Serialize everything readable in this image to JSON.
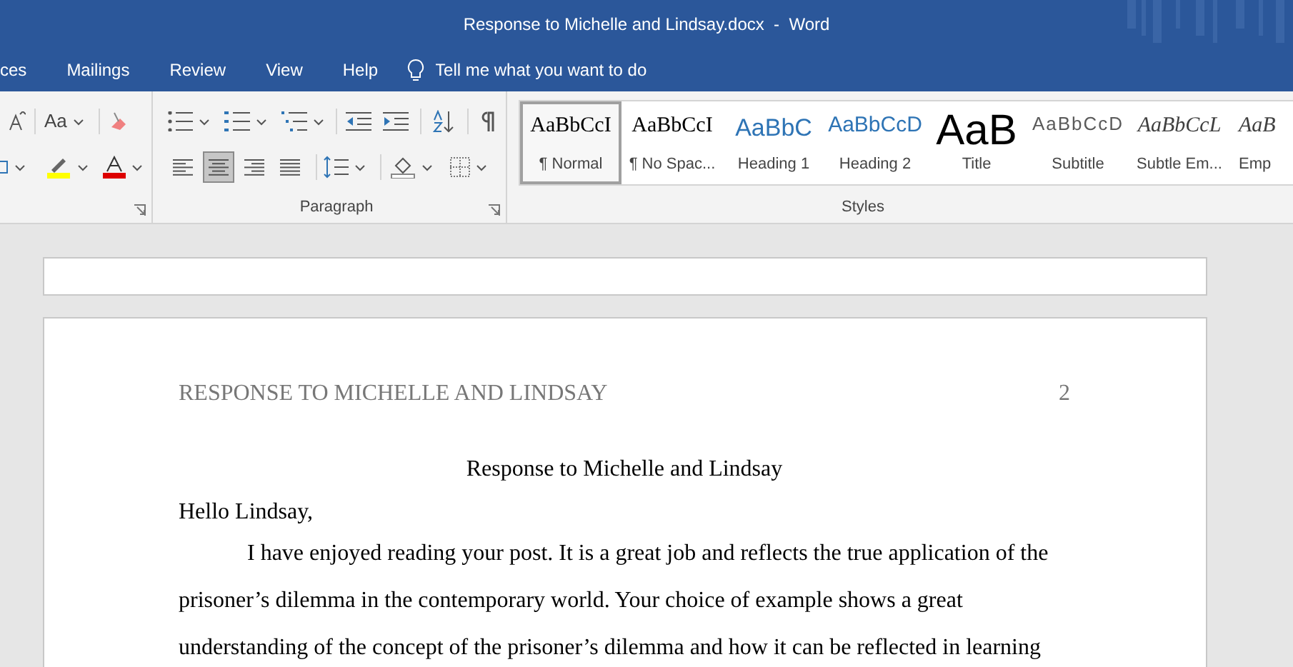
{
  "window": {
    "title": "Response to Michelle and Lindsay.docx  -  Word"
  },
  "tabs": [
    {
      "label": "ces",
      "selected": false
    },
    {
      "label": "Mailings",
      "selected": false
    },
    {
      "label": "Review",
      "selected": false
    },
    {
      "label": "View",
      "selected": false
    },
    {
      "label": "Help",
      "selected": false
    }
  ],
  "tell_me": {
    "placeholder": "Tell me what you want to do"
  },
  "font_group": {
    "change_case": "Aa"
  },
  "paragraph_group": {
    "label": "Paragraph",
    "alignment": [
      {
        "kind": "left",
        "selected": false
      },
      {
        "kind": "center",
        "selected": true
      },
      {
        "kind": "right",
        "selected": false
      },
      {
        "kind": "justify",
        "selected": false
      }
    ]
  },
  "styles_group": {
    "label": "Styles",
    "styles": [
      {
        "kind": "serif",
        "preview": "AaBbCcI",
        "label": "¶ Normal",
        "selected": true
      },
      {
        "kind": "serif",
        "preview": "AaBbCcI",
        "label": "¶ No Spac...",
        "selected": false
      },
      {
        "kind": "heading",
        "preview": "AaBbC",
        "label": "Heading 1",
        "selected": false
      },
      {
        "kind": "heading2",
        "preview": "AaBbCcD",
        "label": "Heading 2",
        "selected": false
      },
      {
        "kind": "title",
        "preview": "AaB",
        "label": "Title",
        "selected": false
      },
      {
        "kind": "subtitle",
        "preview": "AaBbCcD",
        "label": "Subtitle",
        "selected": false
      },
      {
        "kind": "emphasis",
        "preview": "AaBbCcL",
        "label": "Subtle Em...",
        "selected": false
      },
      {
        "kind": "emphasis",
        "preview": "AaB",
        "label": "Emp",
        "selected": false
      }
    ]
  },
  "document": {
    "running_head": "RESPONSE TO MICHELLE AND LINDSAY",
    "page_number": "2",
    "title": "Response to Michelle and Lindsay",
    "greeting": "Hello Lindsay,",
    "lines": [
      "I have enjoyed reading your post. It is a great job and reflects the true application of the",
      "prisoner’s dilemma in the contemporary world. Your choice of example shows a great",
      "understanding of the concept of the prisoner’s dilemma and how it can be reflected in learning"
    ]
  }
}
